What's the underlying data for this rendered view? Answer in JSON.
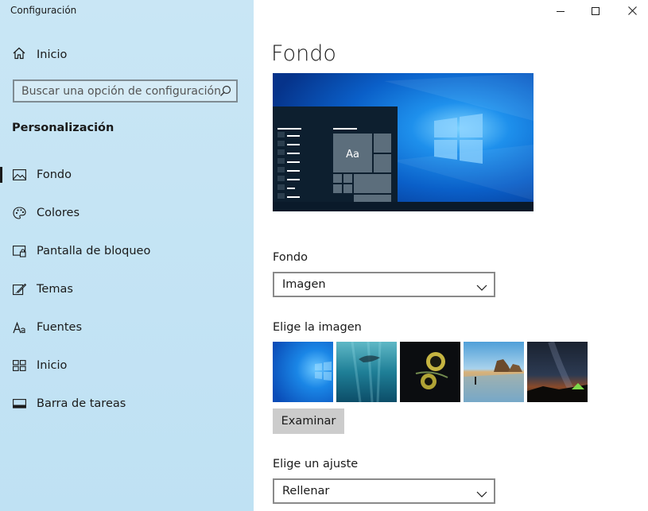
{
  "window": {
    "title": "Configuración"
  },
  "sidebar": {
    "home_label": "Inicio",
    "search_placeholder": "Buscar una opción de configuración",
    "section_title": "Personalización",
    "items": [
      {
        "label": "Fondo",
        "icon": "picture-icon",
        "active": true
      },
      {
        "label": "Colores",
        "icon": "palette-icon",
        "active": false
      },
      {
        "label": "Pantalla de bloqueo",
        "icon": "lock-screen-icon",
        "active": false
      },
      {
        "label": "Temas",
        "icon": "themes-icon",
        "active": false
      },
      {
        "label": "Fuentes",
        "icon": "fonts-icon",
        "active": false
      },
      {
        "label": "Inicio",
        "icon": "start-icon",
        "active": false
      },
      {
        "label": "Barra de tareas",
        "icon": "taskbar-icon",
        "active": false
      }
    ]
  },
  "main": {
    "page_title": "Fondo",
    "preview_tile_text": "Aa",
    "background_label": "Fondo",
    "background_value": "Imagen",
    "choose_image_label": "Elige la imagen",
    "browse_label": "Examinar",
    "fit_label": "Elige un ajuste",
    "fit_value": "Rellenar"
  },
  "colors": {
    "sidebar_bg": "#c4e4f5",
    "accent": "#0078d7",
    "button_bg": "#cccccc"
  }
}
